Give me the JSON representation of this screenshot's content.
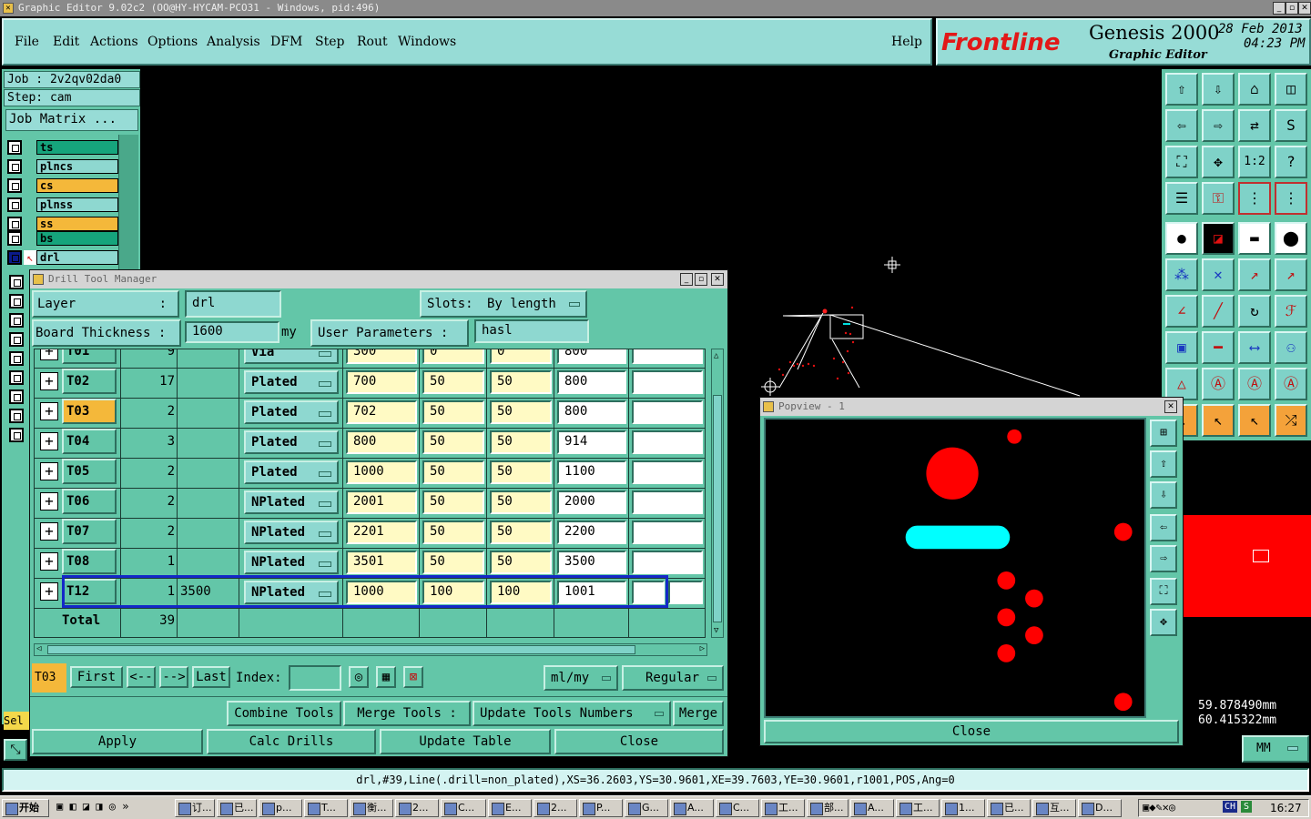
{
  "window": {
    "title": "Graphic Editor 9.02c2 (OO@HY-HYCAM-PCO31 - Windows, pid:496)"
  },
  "menu": [
    "File",
    "Edit",
    "Actions",
    "Options",
    "Analysis",
    "DFM",
    "Step",
    "Rout",
    "Windows"
  ],
  "help_label": "Help",
  "brand": {
    "logo": "Frontline",
    "product": "Genesis 2000",
    "subtitle": "Graphic Editor",
    "date": "28 Feb 2013",
    "time": "04:23 PM"
  },
  "left_panel": {
    "job": "Job : 2v2qv02da0",
    "step": "Step: cam",
    "job_matrix": "Job Matrix ...",
    "layers": [
      {
        "name": "ts",
        "color": "#16a47c"
      },
      {
        "name": "plncs",
        "color": "#8ed8d0"
      },
      {
        "name": "cs",
        "color": "#f4b83a"
      },
      {
        "name": "plnss",
        "color": "#8ed8d0"
      },
      {
        "name": "ss",
        "color": "#f4b83a"
      },
      {
        "name": "bs",
        "color": "#16a47c"
      },
      {
        "name": "drl",
        "color": "#8ed8d0"
      }
    ],
    "sel_label": "Sel"
  },
  "dtm": {
    "title": "Drill Tool Manager",
    "layer_label": "Layer",
    "layer_colon": ":",
    "layer_value": "drl",
    "slots_label": "Slots:",
    "slots_value": "By length",
    "board_thickness_label": "Board Thickness :",
    "board_thickness_value": "1600",
    "unit": "my",
    "user_params_label": "User Parameters :",
    "user_params_value": "hasl",
    "rows": [
      {
        "tool": "T01",
        "count": "9",
        "slot": "",
        "type": "Via",
        "size": "300",
        "tol1": "0",
        "tol2": "0",
        "fin": "800"
      },
      {
        "tool": "T02",
        "count": "17",
        "slot": "",
        "type": "Plated",
        "size": "700",
        "tol1": "50",
        "tol2": "50",
        "fin": "800"
      },
      {
        "tool": "T03",
        "count": "2",
        "slot": "",
        "type": "Plated",
        "size": "702",
        "tol1": "50",
        "tol2": "50",
        "fin": "800"
      },
      {
        "tool": "T04",
        "count": "3",
        "slot": "",
        "type": "Plated",
        "size": "800",
        "tol1": "50",
        "tol2": "50",
        "fin": "914"
      },
      {
        "tool": "T05",
        "count": "2",
        "slot": "",
        "type": "Plated",
        "size": "1000",
        "tol1": "50",
        "tol2": "50",
        "fin": "1100"
      },
      {
        "tool": "T06",
        "count": "2",
        "slot": "",
        "type": "NPlated",
        "size": "2001",
        "tol1": "50",
        "tol2": "50",
        "fin": "2000"
      },
      {
        "tool": "T07",
        "count": "2",
        "slot": "",
        "type": "NPlated",
        "size": "2201",
        "tol1": "50",
        "tol2": "50",
        "fin": "2200"
      },
      {
        "tool": "T08",
        "count": "1",
        "slot": "",
        "type": "NPlated",
        "size": "3501",
        "tol1": "50",
        "tol2": "50",
        "fin": "3500"
      },
      {
        "tool": "T12",
        "count": "1",
        "slot": "3500",
        "type": "NPlated",
        "size": "1000",
        "tol1": "100",
        "tol2": "100",
        "fin": "1001"
      }
    ],
    "total_label": "Total",
    "total_value": "39",
    "current_tool": "T03",
    "nav": {
      "first": "First",
      "prev": "<--",
      "next": "-->",
      "last": "Last",
      "index_label": "Index:"
    },
    "units_select": "ml/my",
    "mode_select": "Regular",
    "combine_tools": "Combine Tools",
    "merge_tools": "Merge Tools :",
    "update_numbers": "Update Tools Numbers",
    "merge": "Merge",
    "apply": "Apply",
    "calc_drills": "Calc Drills",
    "update_table": "Update Table",
    "close": "Close"
  },
  "popview": {
    "title": "Popview - 1",
    "close": "Close"
  },
  "coords": {
    "x": "59.878490mm",
    "y": "60.415322mm",
    "units": "MM"
  },
  "status": "drl,#39,Line(.drill=non_plated),XS=36.2603,YS=30.9601,XE=39.7603,YE=30.9601,r1001,POS,Ang=0",
  "taskbar": {
    "start": "开始",
    "items": [
      "订...",
      "已...",
      "p...",
      "T...",
      "衡...",
      "2...",
      "C...",
      "E...",
      "2...",
      "P...",
      "G...",
      "A...",
      "C...",
      "工...",
      "部...",
      "A...",
      "工...",
      "1...",
      "已...",
      "互...",
      "D..."
    ],
    "clock": "16:27",
    "lang": "CH"
  }
}
